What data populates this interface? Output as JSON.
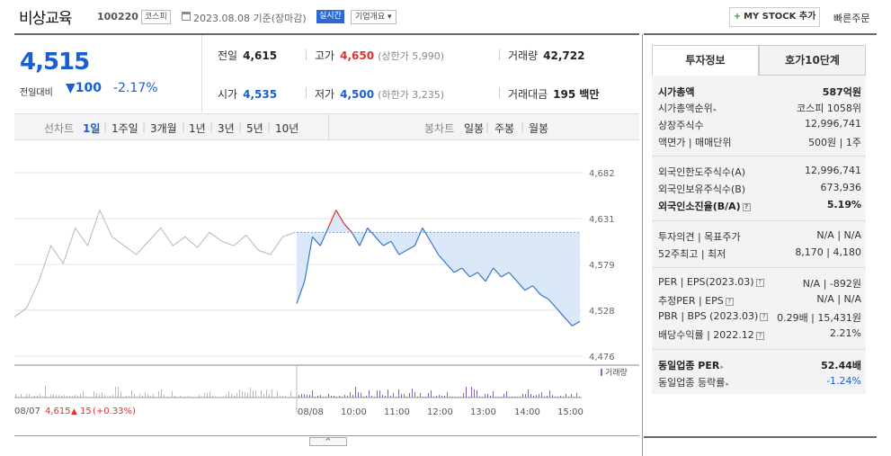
{
  "header": {
    "stock_name": "비상교육",
    "stock_code": "100220",
    "market": "코스피",
    "date": "2023.08.08 기준(장마감)",
    "realtime": "실시간",
    "company_overview": "기업개요",
    "mystock_label": "MY STOCK 추가",
    "quick_order": "빠른주문"
  },
  "price": {
    "current": "4,515",
    "prev_label": "전일대비",
    "change": "100",
    "change_pct": "-2.17%"
  },
  "stats": {
    "prev_close_label": "전일",
    "prev_close": "4,615",
    "high_label": "고가",
    "high": "4,650",
    "high_limit": "(상한가 5,990)",
    "volume_label": "거래량",
    "volume": "42,722",
    "open_label": "시가",
    "open": "4,535",
    "low_label": "저가",
    "low": "4,500",
    "low_limit": "(하한가 3,235)",
    "amount_label": "거래대금",
    "amount": "195 백만"
  },
  "range_bar": {
    "line_chart": "선차트",
    "ranges": [
      "1일",
      "1주일",
      "3개월",
      "1년",
      "3년",
      "5년",
      "10년"
    ],
    "candle_chart": "봉차트",
    "candles": [
      "일봉",
      "주봉",
      "월봉"
    ]
  },
  "chart_data": {
    "type": "line",
    "y_ticks": [
      "4,682",
      "4,631",
      "4,579",
      "4,528",
      "4,476"
    ],
    "ylim": [
      4476,
      4682
    ],
    "reference": 4615,
    "x_ticks": [
      "08/08",
      "10:00",
      "11:00",
      "12:00",
      "13:00",
      "14:00",
      "15:00"
    ],
    "prev_day": {
      "date": "08/07",
      "close": "4,615",
      "change": "15",
      "change_pct": "(+0.33%)"
    },
    "volume_label": "거래량",
    "prev_series": [
      4520,
      4530,
      4560,
      4600,
      4580,
      4620,
      4600,
      4640,
      4610,
      4600,
      4590,
      4605,
      4620,
      4600,
      4610,
      4598,
      4615,
      4605,
      4600,
      4612,
      4595,
      4590,
      4610,
      4615
    ],
    "series": [
      {
        "name": "today",
        "values": [
          4535,
          4560,
          4610,
          4600,
          4620,
          4640,
          4625,
          4615,
          4600,
          4620,
          4610,
          4600,
          4605,
          4590,
          4595,
          4600,
          4620,
          4605,
          4590,
          4580,
          4570,
          4575,
          4565,
          4570,
          4560,
          4575,
          4565,
          4570,
          4560,
          4550,
          4555,
          4545,
          4540,
          4530,
          4520,
          4510,
          4515
        ]
      }
    ],
    "colors": {
      "up": "#e03030",
      "down": "#3575d0",
      "prev": "#b8b8b8",
      "fill": "#dbe8f7"
    }
  },
  "panel": {
    "tab_active": "투자정보",
    "tab_inactive": "호가10단계",
    "rows": [
      {
        "k": "시가총액",
        "v": "587억원",
        "bold": true
      },
      {
        "k": "시가총액순위",
        "v": "코스피 1058위",
        "arrow": true
      },
      {
        "k": "상장주식수",
        "v": "12,996,741"
      },
      {
        "k": "액면가 | 매매단위",
        "v": "500원 | 1주"
      },
      {
        "k": "외국인한도주식수(A)",
        "v": "12,996,741"
      },
      {
        "k": "외국인보유주식수(B)",
        "v": "673,936"
      },
      {
        "k": "외국인소진율(B/A)",
        "v": "5.19%",
        "bold": true,
        "q": true
      },
      {
        "k": "투자의견 | 목표주가",
        "v": "N/A | N/A"
      },
      {
        "k": "52주최고 | 최저",
        "v": "8,170 | 4,180"
      },
      {
        "k": "PER | EPS(2023.03)",
        "v": "N/A | -892원",
        "q": true
      },
      {
        "k": "추정PER | EPS",
        "v": "N/A | N/A",
        "q": true
      },
      {
        "k": "PBR | BPS (2023.03)",
        "v": "0.29배 | 15,431원",
        "q": true
      },
      {
        "k": "배당수익률 | 2022.12",
        "v": "2.21%",
        "q": true
      },
      {
        "k": "동일업종 PER",
        "v": "52.44배",
        "bold": true,
        "arrow": true
      },
      {
        "k": "동일업종 등락률",
        "v": "-1.24%",
        "blue": true,
        "arrow": true
      }
    ]
  }
}
